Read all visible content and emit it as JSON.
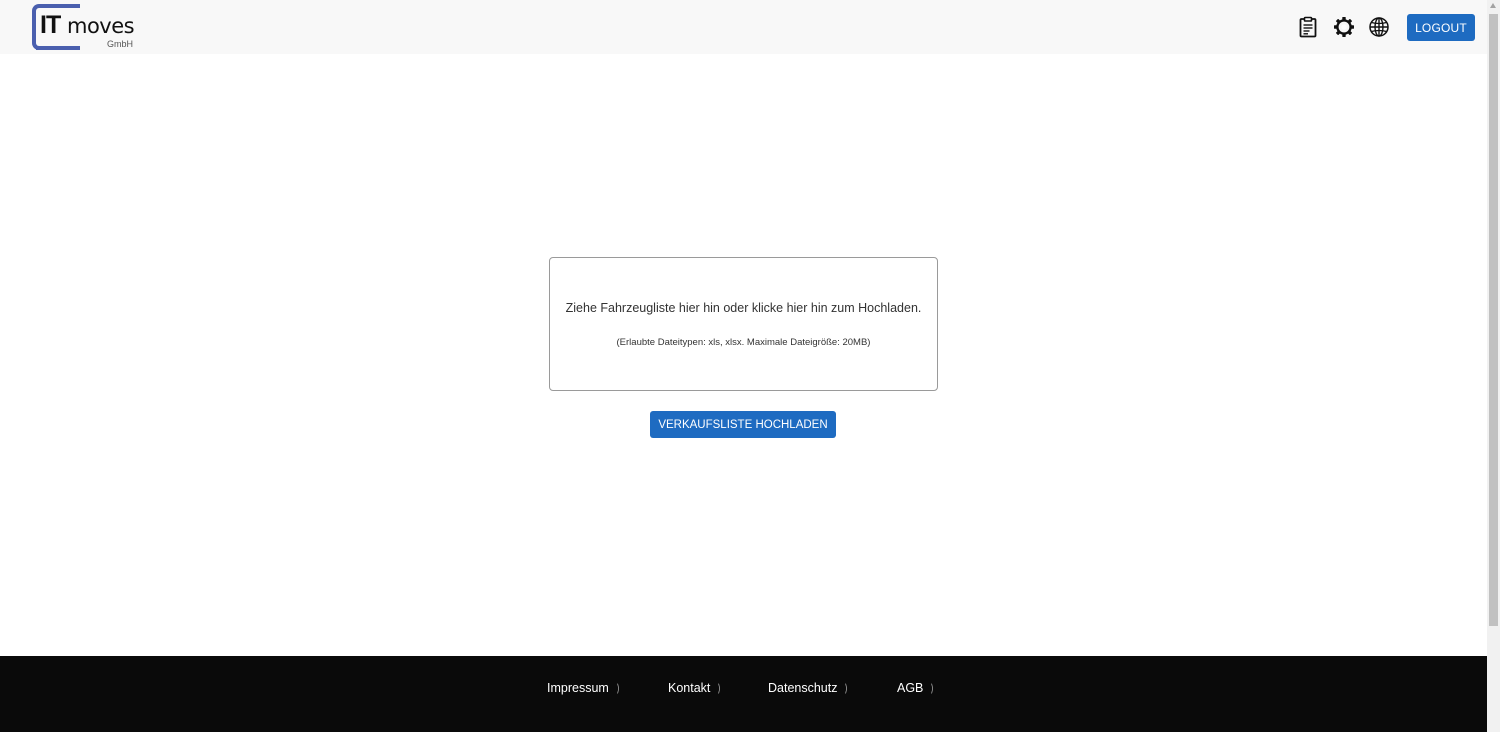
{
  "header": {
    "logo": {
      "it": "IT",
      "moves": "moves",
      "gmbh": "GmbH"
    },
    "icons": [
      "clipboard-icon",
      "gear-icon",
      "globe-icon"
    ],
    "logout_label": "LOGOUT"
  },
  "main": {
    "dropzone": {
      "main_text": "Ziehe Fahrzeugliste hier hin oder klicke hier hin zum Hochladen.",
      "sub_text": "(Erlaubte Dateitypen: xls, xlsx. Maximale Dateigröße: 20MB)"
    },
    "upload_button_label": "VERKAUFSLISTE HOCHLADEN"
  },
  "footer": {
    "links": [
      {
        "label": "Impressum",
        "chevron": "⟩"
      },
      {
        "label": "Kontakt",
        "chevron": "⟩"
      },
      {
        "label": "Datenschutz",
        "chevron": "⟩"
      },
      {
        "label": "AGB",
        "chevron": "⟩"
      }
    ]
  },
  "colors": {
    "accent": "#1e6bc1",
    "logo_blue": "#4a5fae",
    "footer_bg": "#0a0a0a",
    "header_bg": "#f8f8f8"
  }
}
